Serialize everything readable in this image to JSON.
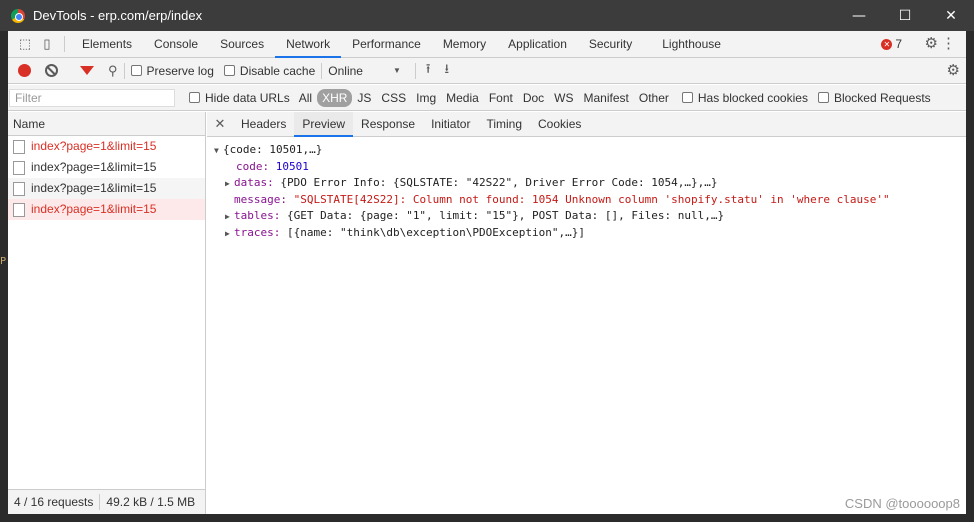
{
  "window": {
    "title": "DevTools - erp.com/erp/index",
    "minimize_glyph": "—",
    "maximize_glyph": "☐",
    "close_glyph": "✕"
  },
  "main_tabs": [
    "Elements",
    "Console",
    "Sources",
    "Network",
    "Performance",
    "Memory",
    "Application",
    "Security",
    "Lighthouse"
  ],
  "active_main_tab": "Network",
  "error_count": "7",
  "toolbar": {
    "preserve_log": "Preserve log",
    "disable_cache": "Disable cache",
    "throttling": "Online",
    "dropdown_glyph": "▼"
  },
  "filterbar": {
    "placeholder": "Filter",
    "hide_data_urls": "Hide data URLs",
    "types": [
      "All",
      "XHR",
      "JS",
      "CSS",
      "Img",
      "Media",
      "Font",
      "Doc",
      "WS",
      "Manifest",
      "Other"
    ],
    "active_type": "XHR",
    "has_blocked_cookies": "Has blocked cookies",
    "blocked_requests": "Blocked Requests"
  },
  "requests": {
    "column_name": "Name",
    "rows": [
      {
        "name": "index?page=1&limit=15",
        "status": "error"
      },
      {
        "name": "index?page=1&limit=15",
        "status": "ok"
      },
      {
        "name": "index?page=1&limit=15",
        "status": "ok"
      },
      {
        "name": "index?page=1&limit=15",
        "status": "error-selected"
      }
    ]
  },
  "status": {
    "requests": "4 / 16 requests",
    "transferred": "49.2 kB / 1.5 MB"
  },
  "detail": {
    "tabs": [
      "Headers",
      "Preview",
      "Response",
      "Initiator",
      "Timing",
      "Cookies"
    ],
    "active_tab": "Preview",
    "preview": {
      "root": "{code: 10501,…}",
      "code_key": "code:",
      "code_val": "10501",
      "datas_key": "datas:",
      "datas_val": "{PDO Error Info: {SQLSTATE: \"42S22\", Driver Error Code: 1054,…},…}",
      "message_key": "message:",
      "message_val": "\"SQLSTATE[42S22]: Column not found: 1054 Unknown column 'shopify.statu' in 'where clause'\"",
      "tables_key": "tables:",
      "tables_val": "{GET Data: {page: \"1\", limit: \"15\"}, POST Data: [], Files: null,…}",
      "traces_key": "traces:",
      "traces_val": "[{name: \"think\\db\\exception\\PDOException\",…}]"
    }
  },
  "watermark": "CSDN @toooooop8",
  "colors": {
    "accent": "#1a73e8",
    "error": "#d93025",
    "key": "#881391",
    "number": "#1c00cf",
    "string": "#c41a16"
  }
}
